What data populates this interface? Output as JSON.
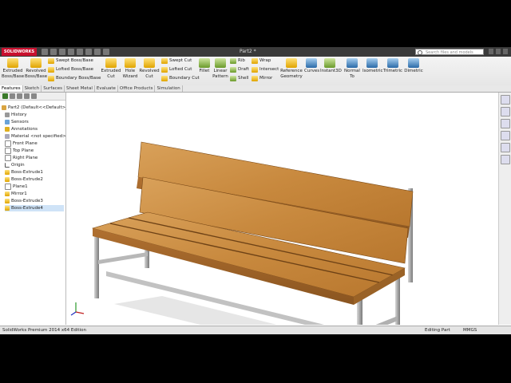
{
  "titlebar": {
    "logo": "SOLIDWORKS",
    "document": "Part2 *",
    "search_placeholder": "Search files and models"
  },
  "ribbon": {
    "extruded_boss": "Extruded Boss/Base",
    "revolved_boss": "Revolved Boss/Base",
    "swept_boss": "Swept Boss/Base",
    "lofted_boss": "Lofted Boss/Base",
    "boundary_boss": "Boundary Boss/Base",
    "extruded_cut": "Extruded Cut",
    "hole_wizard": "Hole Wizard",
    "revolved_cut": "Revolved Cut",
    "swept_cut": "Swept Cut",
    "lofted_cut": "Lofted Cut",
    "boundary_cut": "Boundary Cut",
    "fillet": "Fillet",
    "linear_pattern": "Linear Pattern",
    "rib": "Rib",
    "draft": "Draft",
    "shell": "Shell",
    "wrap": "Wrap",
    "intersect": "Intersect",
    "mirror": "Mirror",
    "reference_geometry": "Reference Geometry",
    "curves": "Curves",
    "instant3d": "Instant3D",
    "normal_to": "Normal To",
    "isometric": "Isometric",
    "trimetric": "Trimetric",
    "dimetric": "Dimetric"
  },
  "tabs": [
    "Features",
    "Sketch",
    "Surfaces",
    "Sheet Metal",
    "Evaluate",
    "Office Products",
    "Simulation"
  ],
  "tree": [
    "Part2 (Default<<Default>_D",
    "History",
    "Sensors",
    "Annotations",
    "Material <not specified>",
    "Front Plane",
    "Top Plane",
    "Right Plane",
    "Origin",
    "Boss-Extrude1",
    "Boss-Extrude2",
    "Plane1",
    "Mirror1",
    "Boss-Extrude3",
    "Boss-Extrude4"
  ],
  "status": {
    "edition": "SolidWorks Premium 2014 x64 Edition",
    "mode": "Editing Part",
    "units": "MMGS"
  },
  "colors": {
    "wood": "#c8893e",
    "metal": "#b5b5b5",
    "selection": "#cfe3f7"
  }
}
